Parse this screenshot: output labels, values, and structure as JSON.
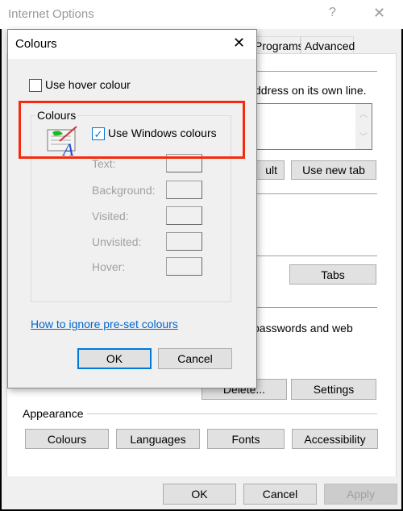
{
  "window": {
    "title": "Internet Options",
    "help": "?",
    "close": "✕"
  },
  "tabs": [
    {
      "label": "Programs"
    },
    {
      "label": "Advanced"
    }
  ],
  "background": {
    "home_text": "ddress on its own line.",
    "use_default_partial": "ult",
    "use_new_tab": "Use new tab",
    "tabs_button": "Tabs",
    "history_text": "passwords and web",
    "delete_button": "Delete...",
    "settings_button": "Settings",
    "appearance_label": "Appearance",
    "appearance_buttons": [
      "Colours",
      "Languages",
      "Fonts",
      "Accessibility"
    ],
    "ok": "OK",
    "cancel": "Cancel",
    "apply": "Apply"
  },
  "dialog": {
    "title": "Colours",
    "close": "✕",
    "use_hover": {
      "label": "Use hover colour",
      "checked": false
    },
    "group_label": "Colours",
    "use_windows": {
      "label": "Use Windows colours",
      "checked": true
    },
    "rows": [
      {
        "label": "Text:"
      },
      {
        "label": "Background:"
      },
      {
        "label": "Visited:"
      },
      {
        "label": "Unvisited:"
      },
      {
        "label": "Hover:"
      }
    ],
    "link": "How to ignore pre-set colours",
    "ok": "OK",
    "cancel": "Cancel"
  },
  "colors": {
    "highlight": "#f42b0d",
    "link": "#0066cc",
    "focus": "#0078d7"
  }
}
